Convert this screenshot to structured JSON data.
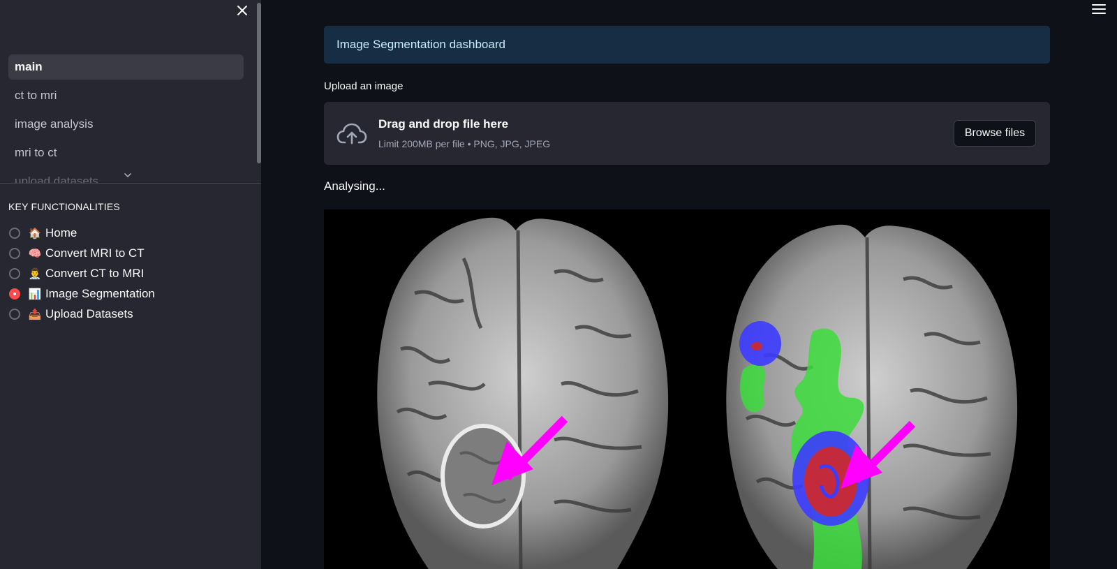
{
  "sidebar": {
    "nav_items": [
      {
        "label": "main"
      },
      {
        "label": "ct to mri"
      },
      {
        "label": "image analysis"
      },
      {
        "label": "mri to ct"
      },
      {
        "label": "upload datasets"
      }
    ],
    "section_heading": "KEY FUNCTIONALITIES",
    "radio_options": [
      {
        "emoji": "🏠",
        "label": "Home",
        "icon": "house-icon",
        "selected": false
      },
      {
        "emoji": "🧠",
        "label": "Convert MRI to CT",
        "icon": "brain-icon",
        "selected": false
      },
      {
        "emoji": "👨‍⚕️",
        "label": "Convert CT to MRI",
        "icon": "doctor-icon",
        "selected": false
      },
      {
        "emoji": "📊",
        "label": "Image Segmentation",
        "icon": "bar-chart-icon",
        "selected": true
      },
      {
        "emoji": "📤",
        "label": "Upload Datasets",
        "icon": "outbox-icon",
        "selected": false
      }
    ]
  },
  "main": {
    "info_box": "Image Segmentation dashboard",
    "upload_label": "Upload an image",
    "dropzone": {
      "title": "Drag and drop file here",
      "limit": "Limit 200MB per file • PNG, JPG, JPEG",
      "browse_label": "Browse files"
    },
    "status_text": "Analysing..."
  },
  "colors": {
    "accent": "#ff4b4b",
    "sidebar_bg": "#262730",
    "app_bg": "#0e1117",
    "info_bg": "#172d43",
    "info_text": "#c7ebff",
    "arrow": "#ff00ff",
    "edema": "#3cdc3c",
    "enhancing": "#3c3cff",
    "necrosis": "#d22828"
  }
}
